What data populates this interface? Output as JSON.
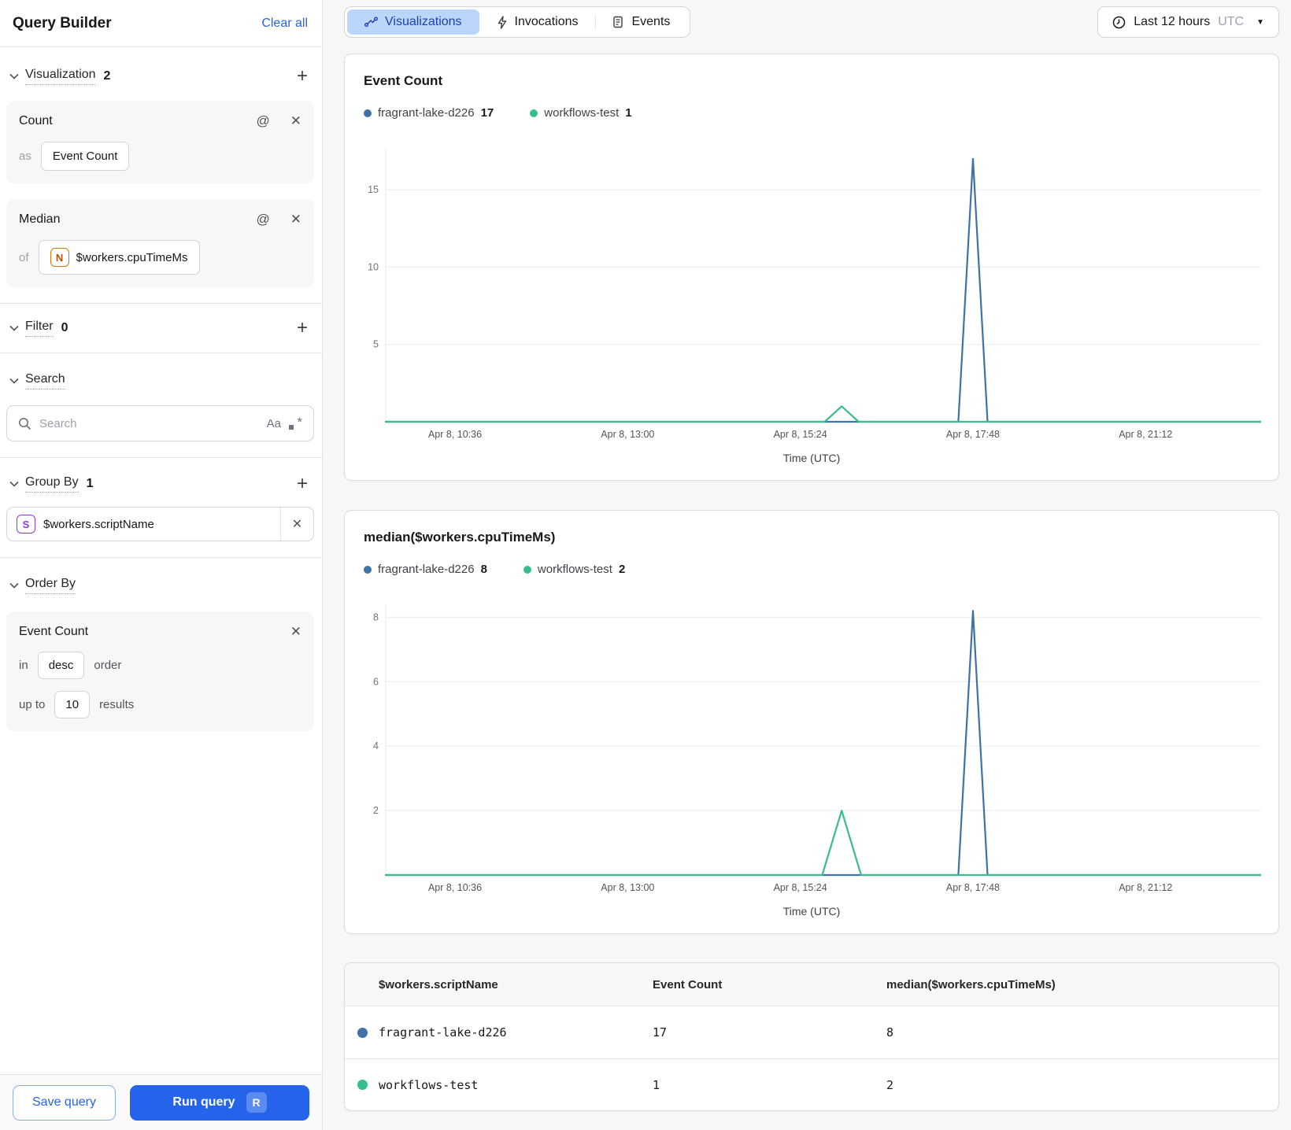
{
  "sidebar": {
    "title": "Query Builder",
    "clear_all": "Clear all",
    "visualization": {
      "label": "Visualization",
      "count": "2",
      "count_card": {
        "title": "Count",
        "prefix": "as",
        "value": "Event Count"
      },
      "median_card": {
        "title": "Median",
        "prefix": "of",
        "icon_letter": "N",
        "value": "$workers.cpuTimeMs"
      }
    },
    "filter": {
      "label": "Filter",
      "count": "0"
    },
    "search": {
      "label": "Search",
      "placeholder": "Search",
      "case_icon": "Aa"
    },
    "group_by": {
      "label": "Group By",
      "count": "1",
      "chip": {
        "icon_letter": "S",
        "value": "$workers.scriptName"
      }
    },
    "order_by": {
      "label": "Order By",
      "card": {
        "title": "Event Count",
        "in_label": "in",
        "order_value": "desc",
        "order_label": "order",
        "upto_label": "up to",
        "limit_value": "10",
        "results_label": "results"
      }
    },
    "footer": {
      "save_label": "Save query",
      "run_label": "Run query",
      "run_kbd": "R"
    }
  },
  "topbar": {
    "tabs": [
      {
        "label": "Visualizations",
        "active": true
      },
      {
        "label": "Invocations",
        "active": false
      },
      {
        "label": "Events",
        "active": false
      }
    ],
    "time_range": {
      "label": "Last 12 hours",
      "zone": "UTC"
    }
  },
  "colors": {
    "blue_series": "#3f72a6",
    "green_series": "#38bd8f",
    "accent": "#2563eb"
  },
  "chart_data": [
    {
      "type": "line",
      "title": "Event Count",
      "xlabel": "Time (UTC)",
      "x_domain": [
        0,
        720
      ],
      "y_domain": [
        0,
        17.7
      ],
      "y_ticks": [
        5,
        10,
        15
      ],
      "x_ticks": [
        {
          "x": 57,
          "label": "Apr 8, 10:36"
        },
        {
          "x": 199,
          "label": "Apr 8, 13:00"
        },
        {
          "x": 341,
          "label": "Apr 8, 15:24"
        },
        {
          "x": 483,
          "label": "Apr 8, 17:48"
        },
        {
          "x": 625,
          "label": "Apr 8, 21:12"
        }
      ],
      "legend": [
        {
          "name": "fragrant-lake-d226",
          "value": "17",
          "color": "#3f72a6"
        },
        {
          "name": "workflows-test",
          "value": "1",
          "color": "#38bd8f"
        }
      ],
      "series": [
        {
          "name": "fragrant-lake-d226",
          "color": "#3f72a6",
          "points": [
            [
              0,
              0
            ],
            [
              471,
              0
            ],
            [
              483,
              17
            ],
            [
              495,
              0
            ],
            [
              720,
              0
            ]
          ]
        },
        {
          "name": "workflows-test",
          "color": "#38bd8f",
          "points": [
            [
              0,
              0
            ],
            [
              361,
              0
            ],
            [
              375,
              1
            ],
            [
              389,
              0
            ],
            [
              720,
              0
            ]
          ]
        }
      ]
    },
    {
      "type": "line",
      "title": "median($workers.cpuTimeMs)",
      "xlabel": "Time (UTC)",
      "x_domain": [
        0,
        720
      ],
      "y_domain": [
        0,
        8.4
      ],
      "y_ticks": [
        2,
        4,
        6,
        8
      ],
      "x_ticks": [
        {
          "x": 57,
          "label": "Apr 8, 10:36"
        },
        {
          "x": 199,
          "label": "Apr 8, 13:00"
        },
        {
          "x": 341,
          "label": "Apr 8, 15:24"
        },
        {
          "x": 483,
          "label": "Apr 8, 17:48"
        },
        {
          "x": 625,
          "label": "Apr 8, 21:12"
        }
      ],
      "legend": [
        {
          "name": "fragrant-lake-d226",
          "value": "8",
          "color": "#3f72a6"
        },
        {
          "name": "workflows-test",
          "value": "2",
          "color": "#38bd8f"
        }
      ],
      "series": [
        {
          "name": "fragrant-lake-d226",
          "color": "#3f72a6",
          "points": [
            [
              0,
              0
            ],
            [
              471,
              0
            ],
            [
              483,
              8.2
            ],
            [
              495,
              0
            ],
            [
              720,
              0
            ]
          ]
        },
        {
          "name": "workflows-test",
          "color": "#38bd8f",
          "points": [
            [
              0,
              0
            ],
            [
              359,
              0
            ],
            [
              375,
              2
            ],
            [
              391,
              0
            ],
            [
              720,
              0
            ]
          ]
        }
      ]
    }
  ],
  "table": {
    "headers": [
      "$workers.scriptName",
      "Event Count",
      "median($workers.cpuTimeMs)"
    ],
    "rows": [
      {
        "color": "#3f72a6",
        "name": "fragrant-lake-d226",
        "event_count": "17",
        "median": "8"
      },
      {
        "color": "#38bd8f",
        "name": "workflows-test",
        "event_count": "1",
        "median": "2"
      }
    ]
  }
}
